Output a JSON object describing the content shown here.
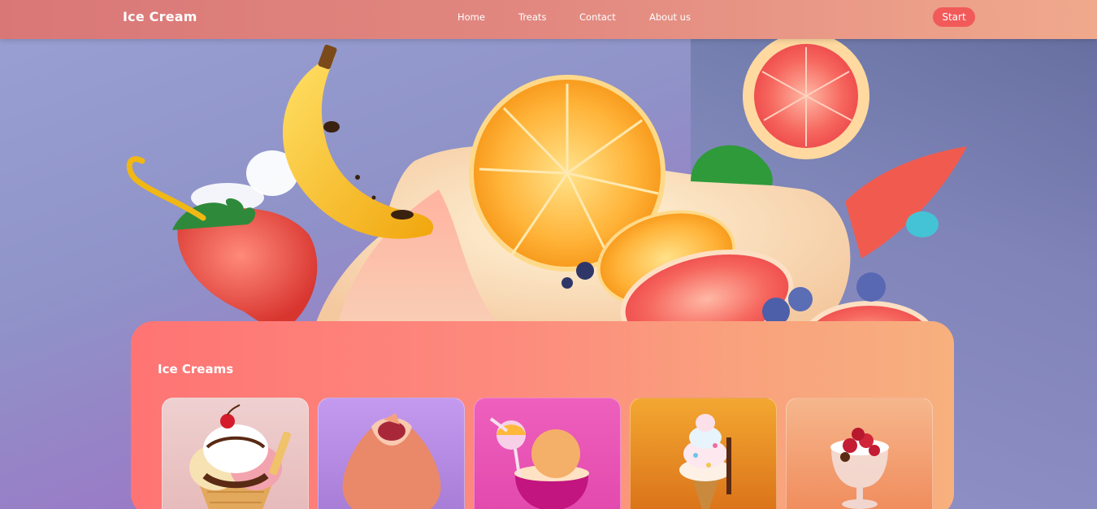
{
  "navbar": {
    "brand": "Ice Cream",
    "links": [
      "Home",
      "Treats",
      "Contact",
      "About us"
    ],
    "start_label": "Start"
  },
  "section": {
    "title": "Ice Creams"
  },
  "cards": [
    {
      "name": "sundae-cone",
      "bg": "#e9c2c2"
    },
    {
      "name": "peach-scoop",
      "bg": "#b58be3"
    },
    {
      "name": "bowl-scoop",
      "bg": "#ea57b3"
    },
    {
      "name": "soft-serve-cone",
      "bg": "#e68b27"
    },
    {
      "name": "berry-cup",
      "bg": "#f4a374"
    }
  ]
}
